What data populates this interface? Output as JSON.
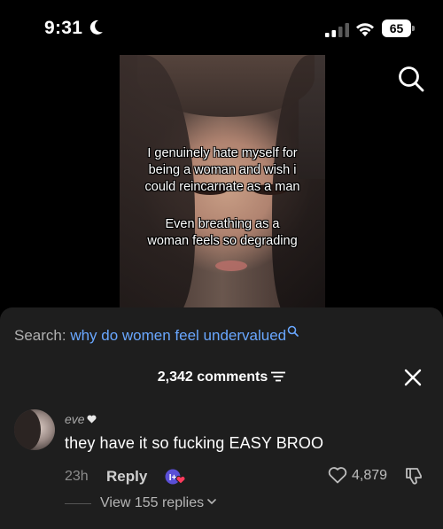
{
  "status_bar": {
    "time": "9:31",
    "battery": "65",
    "icons": [
      "moon-icon",
      "signal-icon",
      "wifi-icon",
      "battery-icon"
    ]
  },
  "top_bar": {
    "search_icon": "search-icon"
  },
  "video": {
    "overlay_line_1": "I genuinely hate myself for\nbeing a woman and wish i\ncould reincarnate as a man",
    "overlay_line_2": "Even breathing as a\nwoman feels so degrading"
  },
  "comments_sheet": {
    "search_prefix": "Search: ",
    "search_query": "why do women feel undervalued",
    "comments_count": "2,342 comments",
    "comment": {
      "username": "eve",
      "text": "they have it so fucking EASY BROO",
      "timestamp": "23h",
      "reply_label": "Reply",
      "like_count": "4,879",
      "view_replies": "View 155 replies"
    }
  },
  "colors": {
    "background": "#000000",
    "sheet": "#1e1e1e",
    "search_query": "#69a7ff",
    "creator_badge": "#5a4fd6",
    "badge_heart": "#ff3b5c"
  }
}
